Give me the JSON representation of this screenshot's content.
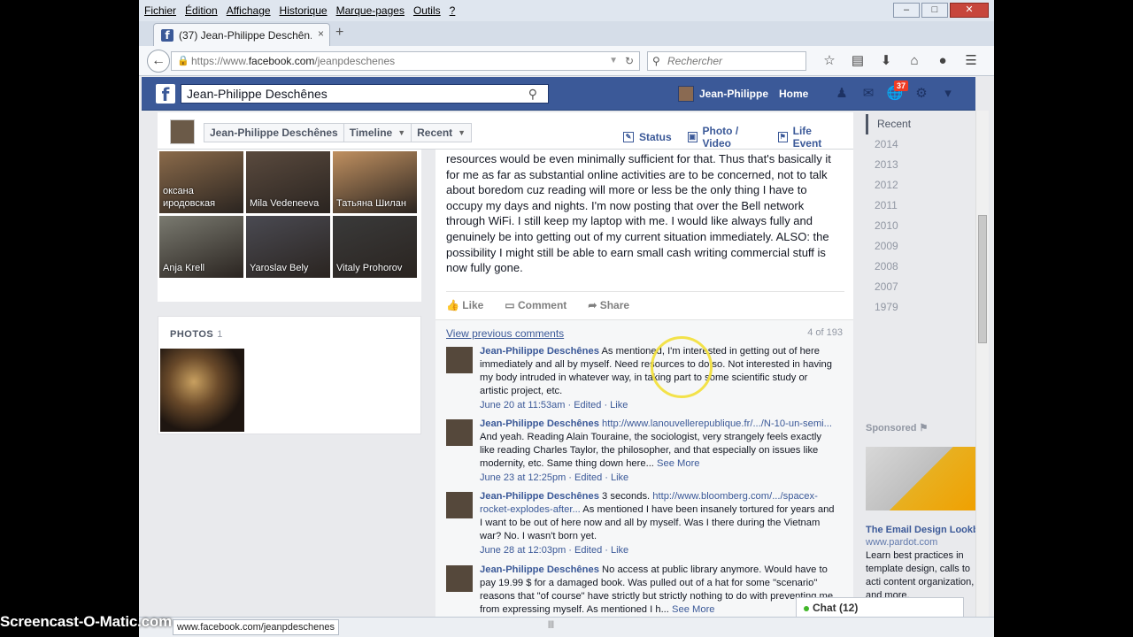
{
  "browser": {
    "menu": [
      "Fichier",
      "Édition",
      "Affichage",
      "Historique",
      "Marque-pages",
      "Outils",
      "?"
    ],
    "tab_title": "(37) Jean-Philippe Deschên...",
    "tab_close": "×",
    "new_tab": "+",
    "url_prefix": "https://www.",
    "url_domain": "facebook.com",
    "url_path": "/jeanpdeschenes",
    "search_placeholder": "Rechercher",
    "status_url": "www.facebook.com/jeanpdeschenes",
    "window_buttons": [
      "–",
      "□",
      "✕"
    ]
  },
  "facebook": {
    "search_value": "Jean-Philippe Deschênes",
    "user_name": "Jean-Philippe",
    "home": "Home",
    "notifications": "37"
  },
  "timeline_header": {
    "name": "Jean-Philippe Deschênes",
    "timeline": "Timeline",
    "recent": "Recent",
    "composer": [
      "Status",
      "Photo / Video",
      "Life Event"
    ]
  },
  "friends": [
    {
      "name": "оксана\nиродовская",
      "color": "#8a6a4a"
    },
    {
      "name": "Mila Vedeneeva",
      "color": "#5a4a3e"
    },
    {
      "name": "Татьяна Шилан",
      "color": "#c09060"
    },
    {
      "name": "Anja Krell",
      "color": "#7a7a70"
    },
    {
      "name": "Yaroslav Bely",
      "color": "#4a4a52"
    },
    {
      "name": "Vitaly Prohorov",
      "color": "#3a3a3a"
    }
  ],
  "photos": {
    "label": "PHOTOS",
    "count": "1"
  },
  "post": {
    "text": "resources would be even minimally sufficient for that. Thus that's basically it for me as far as substantial online activities are to be concerned, not to talk about boredom cuz reading will more or less be the only thing I have to occupy my days and nights. I'm now posting that over the Bell network through WiFi. I still keep my laptop with me. I would like always fully and genuinely be into getting out of my current situation immediately. ALSO: the possibility I might still be able to earn small cash writing commercial stuff is now fully gone.",
    "actions": [
      "Like",
      "Comment",
      "Share"
    ],
    "view_previous": "View previous comments",
    "comment_count": "4 of 193"
  },
  "comments": [
    {
      "name": "Jean-Philippe Deschênes",
      "link": "",
      "text": "As mentioned, I'm interested in getting out of here immediately and all by myself. Need resources to do so. Not interested in having my body intruded in whatever way, in taking part to some scientific study or artistic project, etc.",
      "more": "",
      "date": "June 20 at 11:53am",
      "edited": " · Edited · ",
      "like": "Like"
    },
    {
      "name": "Jean-Philippe Deschênes",
      "link": "http://www.lanouvellerepublique.fr/.../N-10-un-semi...",
      "text": "And yeah. Reading Alain Touraine, the sociologist, very strangely feels exactly like reading Charles Taylor, the philosopher, and that especially on issues like modernity, etc. Same thing down here...",
      "more": "See More",
      "date": "June 23 at 12:25pm",
      "edited": " · Edited · ",
      "like": "Like"
    },
    {
      "name": "Jean-Philippe Deschênes",
      "link": "",
      "text": "3 seconds.",
      "link2": "http://www.bloomberg.com/.../spacex-rocket-explodes-after...",
      "text2": "As mentioned I have been insanely tortured for years and I want to be out of here now and all by myself. Was I there during the Vietnam war? No. I wasn't born yet.",
      "more": "",
      "date": "June 28 at 12:03pm",
      "edited": " · Edited · ",
      "like": "Like"
    },
    {
      "name": "Jean-Philippe Deschênes",
      "link": "",
      "text": "No access at public library anymore. Would have to pay 19.99 $ for a damaged book. Was pulled out of a hat for some \"scenario\" reasons that \"of course\" have strictly but strictly nothing to do with preventing me from expressing myself. As mentioned I h...",
      "more": "See More",
      "date": "",
      "edited": "",
      "like": ""
    }
  ],
  "sidebar": {
    "years": [
      "Recent",
      "2014",
      "2013",
      "2012",
      "2011",
      "2010",
      "2009",
      "2008",
      "2007",
      "1979"
    ],
    "sponsored": "Sponsored",
    "ad_title": "The Email Design Lookbo",
    "ad_url": "www.pardot.com",
    "ad_text": "Learn best practices in template design, calls to acti content organization, and more."
  },
  "chat": "Chat (12)",
  "watermark": "Screencast-O-Matic.com"
}
